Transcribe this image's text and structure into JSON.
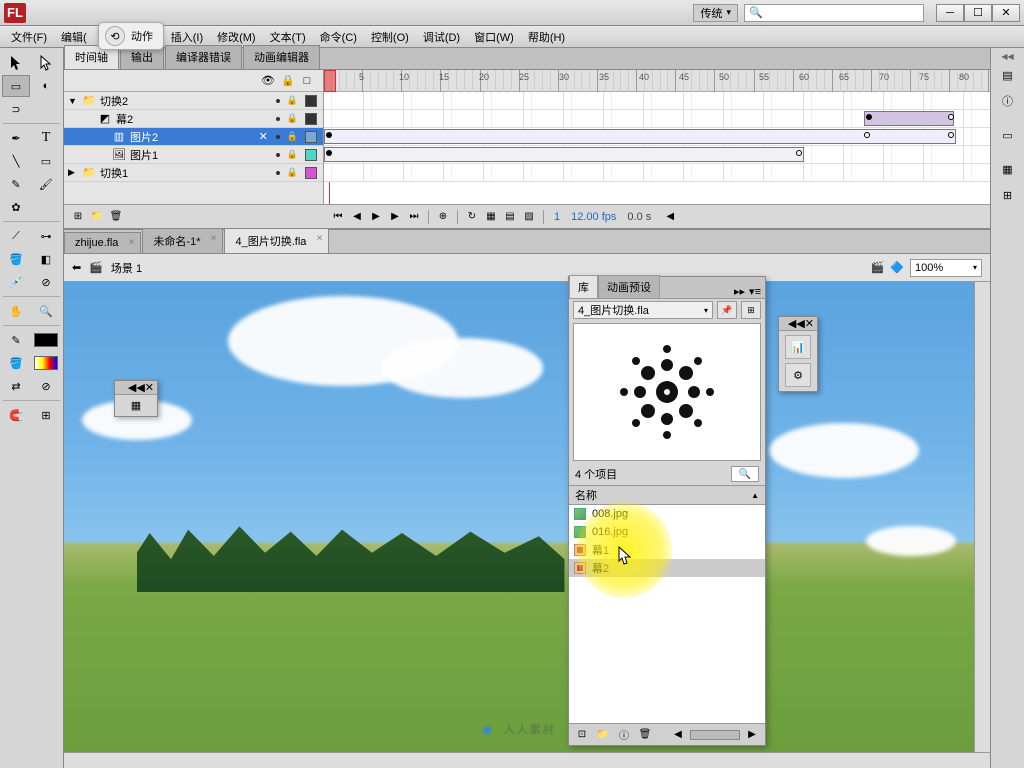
{
  "titlebar": {
    "logo": "FL",
    "workspace": "传统"
  },
  "menu": {
    "file": "文件(F)",
    "edit": "编辑(",
    "insert": "插入(I)",
    "modify": "修改(M)",
    "text": "文本(T)",
    "command": "命令(C)",
    "control": "控制(O)",
    "debug": "调试(D)",
    "window": "窗口(W)",
    "help": "帮助(H)"
  },
  "actions_popup": "动作",
  "timeline": {
    "tabs": {
      "timeline": "时间轴",
      "output": "输出",
      "compiler_errors": "编译器错误",
      "motion_editor": "动画编辑器"
    },
    "layers": [
      {
        "name": "切换2",
        "type": "folder",
        "level": 0,
        "expanded": true,
        "chip": "#333",
        "selected": false
      },
      {
        "name": "幕2",
        "type": "mask",
        "level": 1,
        "chip": "#333",
        "selected": false
      },
      {
        "name": "图片2",
        "type": "masked",
        "level": 2,
        "chip": "#7aa9d6",
        "selected": true
      },
      {
        "name": "图片1",
        "type": "bitmap",
        "level": 2,
        "chip": "#4dd6c8",
        "selected": false
      },
      {
        "name": "切换1",
        "type": "folder",
        "level": 0,
        "expanded": false,
        "chip": "#d355d3",
        "selected": false
      }
    ],
    "ruler_marks": [
      5,
      10,
      15,
      20,
      25,
      30,
      35,
      40,
      45,
      50,
      55,
      60,
      65,
      70,
      75,
      80
    ],
    "status": {
      "frame": "1",
      "fps": "12.00 fps",
      "time": "0.0 s"
    }
  },
  "doc_tabs": [
    {
      "label": "zhijue.fla",
      "active": false
    },
    {
      "label": "未命名-1*",
      "active": false
    },
    {
      "label": "4_图片切换.fla",
      "active": true
    }
  ],
  "scene": {
    "back_icon": "⬅",
    "scene_icon": "🎬",
    "label": "场景 1",
    "zoom": "100%"
  },
  "library": {
    "tabs": {
      "lib": "库",
      "presets": "动画预设"
    },
    "file": "4_图片切换.fla",
    "count": "4 个项目",
    "name_header": "名称",
    "items": [
      {
        "name": "008.jpg",
        "type": "img"
      },
      {
        "name": "016.jpg",
        "type": "img"
      },
      {
        "name": "幕1",
        "type": "mc"
      },
      {
        "name": "幕2",
        "type": "mc",
        "selected": true
      }
    ]
  },
  "watermark": "人人素材"
}
